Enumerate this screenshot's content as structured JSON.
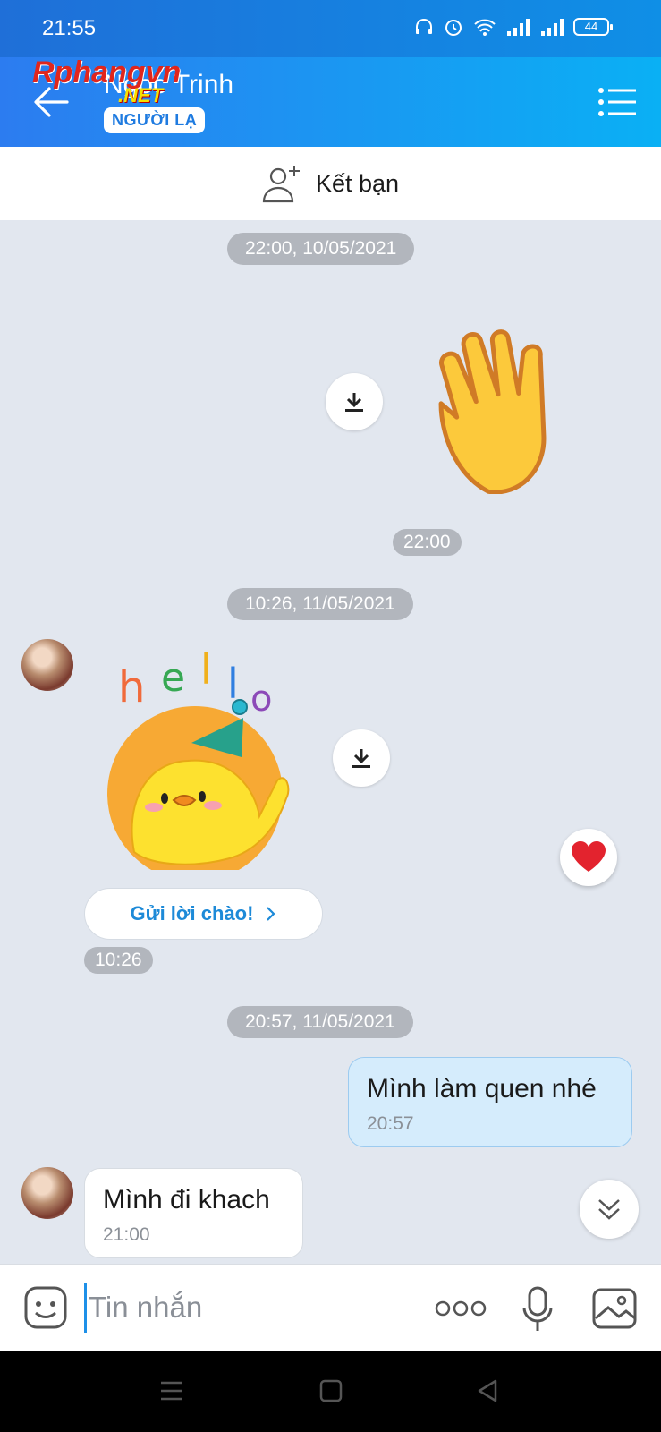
{
  "status": {
    "time": "21:55",
    "battery": "44"
  },
  "header": {
    "name": "Ngọc Trinh",
    "badge": "NGƯỜI LẠ",
    "watermark": "Rphangvn",
    "watermark_net": ".NET"
  },
  "add_friend": {
    "label": "Kết bạn"
  },
  "conversation": {
    "date1": "22:00, 10/05/2021",
    "sticker1_time": "22:00",
    "date2": "10:26, 11/05/2021",
    "greet_label": "Gửi lời chào!",
    "sticker2_time": "10:26",
    "date3": "20:57, 11/05/2021",
    "out_message": {
      "text": "Mình làm quen nhé",
      "time": "20:57"
    },
    "in_message": {
      "text": "Mình đi khach",
      "time": "21:00"
    }
  },
  "composer": {
    "placeholder": "Tin nhắn"
  },
  "icons": [
    "back-arrow-icon",
    "menu-icon",
    "add-friend-icon",
    "download-icon",
    "heart-icon",
    "double-chevron-down-icon",
    "emoji-icon",
    "more-icon",
    "mic-icon",
    "image-icon"
  ],
  "colors": {
    "header": "#2c7cf0",
    "accent": "#1d8ad8",
    "outgoing_bubble": "#d5ecfc",
    "chat_bg": "#e2e7ef"
  }
}
